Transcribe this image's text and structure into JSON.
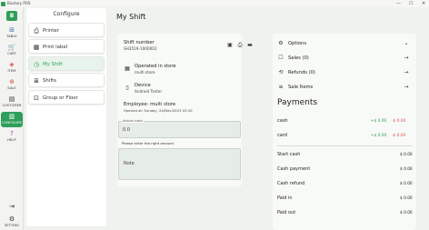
{
  "window": {
    "title": "Bisstory POS",
    "minimize": "—",
    "maximize": "☐",
    "close": "✕"
  },
  "rail": {
    "logo": "B",
    "items": [
      {
        "label": "TABLE",
        "icon": "table-icon",
        "glyph": "⊞"
      },
      {
        "label": "CART",
        "icon": "cart-icon",
        "glyph": "🛒"
      },
      {
        "label": "ITEM",
        "icon": "item-icon",
        "glyph": "◈"
      },
      {
        "label": "SALE",
        "icon": "sale-icon",
        "glyph": "⊕"
      },
      {
        "label": "CUSTOMER",
        "icon": "customer-icon",
        "glyph": "▤"
      },
      {
        "label": "CONFIGURE",
        "icon": "configure-icon",
        "glyph": "▥"
      },
      {
        "label": "HELP",
        "icon": "help-icon",
        "glyph": "?"
      },
      {
        "label": "",
        "icon": "logout-icon",
        "glyph": "⇥"
      },
      {
        "label": "SETTING",
        "icon": "setting-icon",
        "glyph": "⚙"
      }
    ]
  },
  "configure": {
    "title": "Configure",
    "items": [
      {
        "label": "Printer",
        "icon": "printer-icon",
        "glyph": "⎙"
      },
      {
        "label": "Print label",
        "icon": "label-icon",
        "glyph": "▦"
      },
      {
        "label": "My Shift",
        "icon": "shift-icon",
        "glyph": "◷"
      },
      {
        "label": "Shifts",
        "icon": "shifts-icon",
        "glyph": "≣"
      },
      {
        "label": "Group or Floor",
        "icon": "group-icon",
        "glyph": "⊡"
      }
    ]
  },
  "page": {
    "title": "My Shift"
  },
  "shift": {
    "number_label": "Shift number",
    "number_value": "SH3519-1000002",
    "store_label": "Operated in store",
    "store_value": "multi store",
    "device_label": "Device",
    "device_value": "Android Tester",
    "employee_line": "Employee: multi store",
    "opened_line": "Opened at: Sunday, 24/Dec/2023 03:10",
    "actual_cash_label": "Actual cash",
    "actual_cash_value": "0.0",
    "hint": "Please enter the right amount",
    "note_placeholder": "Note"
  },
  "summary": {
    "options_label": "Options",
    "sales_label": "Sales (0)",
    "refunds_label": "Refunds (0)",
    "sale_items_label": "Sale Items",
    "payments_title": "Payments",
    "payments": [
      {
        "label": "cash",
        "plus": "+$ 0.00",
        "minus": "-$ 0.00"
      },
      {
        "label": "card",
        "plus": "+$ 0.00",
        "minus": "-$ 0.00"
      }
    ],
    "totals": [
      {
        "label": "Start cash",
        "value": "$ 0.00"
      },
      {
        "label": "Cash payment",
        "value": "$ 0.00"
      },
      {
        "label": "Cash refund",
        "value": "$ 0.00"
      },
      {
        "label": "Paid in",
        "value": "$ 0.00"
      },
      {
        "label": "Paid out",
        "value": "$ 0.00"
      }
    ]
  }
}
